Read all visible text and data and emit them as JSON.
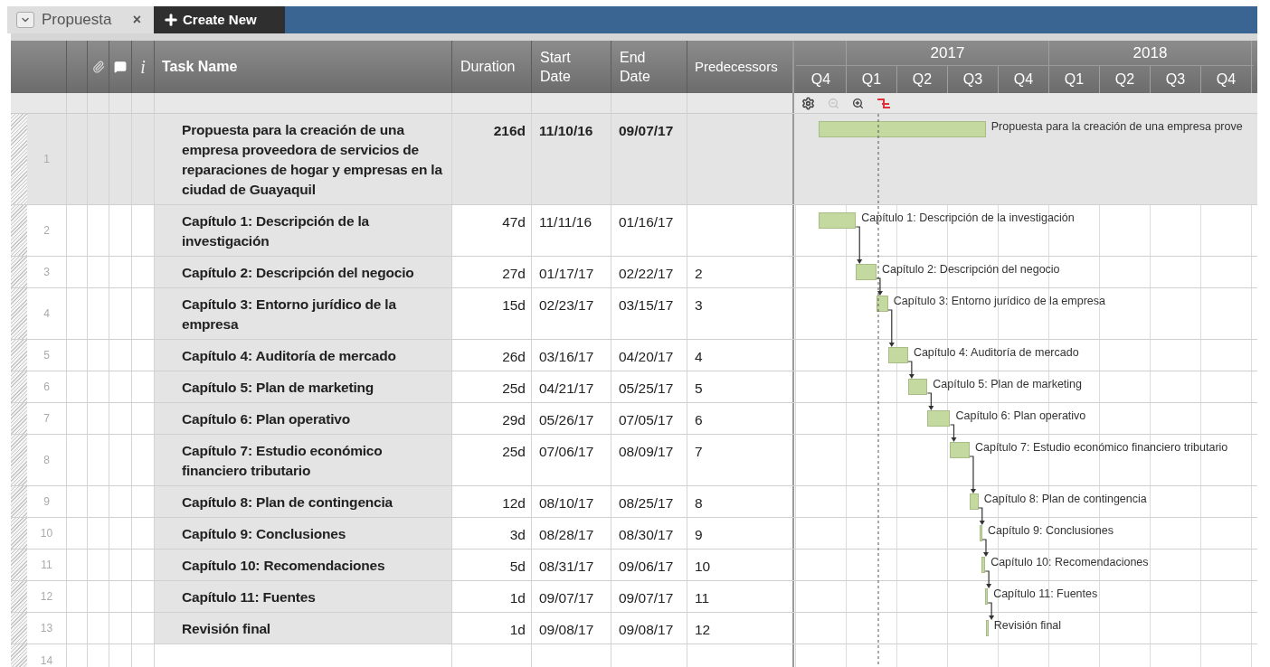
{
  "tab": {
    "label": "Propuesta",
    "close": "×",
    "selected": true
  },
  "create_button": {
    "label": "Create New"
  },
  "columns": {
    "info": "i",
    "task_name": "Task Name",
    "duration": "Duration",
    "start": "Start Date",
    "end": "End Date",
    "predecessors": "Predecessors"
  },
  "timeline": [
    {
      "quarters": [
        "Q4"
      ]
    },
    {
      "year": "2017",
      "quarters": [
        "Q1",
        "Q2",
        "Q3",
        "Q4"
      ]
    },
    {
      "year": "2018",
      "quarters": [
        "Q1",
        "Q2",
        "Q3",
        "Q4"
      ]
    }
  ],
  "tasks": [
    {
      "row": "1",
      "kind": "summary",
      "name": "Propuesta para la creación de una empresa proveedora de servicios de reparaciones de hogar y empresas en la ciudad de Guayaquil",
      "duration": "216d",
      "start": "11/10/16",
      "end": "09/07/17",
      "bar_label": "Propuesta para la creación de una empresa prove"
    },
    {
      "row": "2",
      "kind": "task",
      "name": "Capítulo 1: Descripción de la investigación",
      "duration": "47d",
      "start": "11/11/16",
      "end": "01/16/17",
      "bar_label": "Capítulo 1: Descripción de la investigación"
    },
    {
      "row": "3",
      "kind": "task",
      "name": "Capítulo 2: Descripción del negocio",
      "duration": "27d",
      "start": "01/17/17",
      "end": "02/22/17",
      "predecessors": "2",
      "bar_label": "Capítulo 2: Descripción del negocio"
    },
    {
      "row": "4",
      "kind": "task",
      "name": "Capítulo 3: Entorno jurídico de la empresa",
      "duration": "15d",
      "start": "02/23/17",
      "end": "03/15/17",
      "predecessors": "3",
      "bar_label": "Capítulo 3: Entorno jurídico de la empresa"
    },
    {
      "row": "5",
      "kind": "task",
      "name": "Capítulo 4: Auditoría de mercado",
      "duration": "26d",
      "start": "03/16/17",
      "end": "04/20/17",
      "predecessors": "4",
      "bar_label": "Capítulo 4: Auditoría de mercado"
    },
    {
      "row": "6",
      "kind": "task",
      "name": "Capítulo 5: Plan de marketing",
      "duration": "25d",
      "start": "04/21/17",
      "end": "05/25/17",
      "predecessors": "5",
      "bar_label": "Capítulo 5: Plan de marketing"
    },
    {
      "row": "7",
      "kind": "task",
      "name": "Capítulo 6: Plan operativo",
      "duration": "29d",
      "start": "05/26/17",
      "end": "07/05/17",
      "predecessors": "6",
      "bar_label": "Capítulo 6: Plan operativo"
    },
    {
      "row": "8",
      "kind": "task",
      "name": "Capítulo 7: Estudio económico financiero tributario",
      "duration": "25d",
      "start": "07/06/17",
      "end": "08/09/17",
      "predecessors": "7",
      "bar_label": "Capítulo 7: Estudio económico financiero tributario"
    },
    {
      "row": "9",
      "kind": "task",
      "name": "Capítulo 8: Plan de contingencia",
      "duration": "12d",
      "start": "08/10/17",
      "end": "08/25/17",
      "predecessors": "8",
      "bar_label": "Capítulo 8: Plan de contingencia"
    },
    {
      "row": "10",
      "kind": "task",
      "name": "Capítulo 9: Conclusiones",
      "duration": "3d",
      "start": "08/28/17",
      "end": "08/30/17",
      "predecessors": "9",
      "bar_label": "Capítulo 9: Conclusiones"
    },
    {
      "row": "11",
      "kind": "task",
      "name": "Capítulo 10: Recomendaciones",
      "duration": "5d",
      "start": "08/31/17",
      "end": "09/06/17",
      "predecessors": "10",
      "bar_label": "Capítulo 10: Recomendaciones"
    },
    {
      "row": "12",
      "kind": "task",
      "name": "Capítulo 11: Fuentes",
      "duration": "1d",
      "start": "09/07/17",
      "end": "09/07/17",
      "predecessors": "11",
      "bar_label": "Capítulo 11: Fuentes"
    },
    {
      "row": "13",
      "kind": "task",
      "name": "Revisión final",
      "duration": "1d",
      "start": "09/08/17",
      "end": "09/08/17",
      "predecessors": "12",
      "bar_label": "Revisión final"
    }
  ],
  "empty_rows": [
    "14"
  ]
}
